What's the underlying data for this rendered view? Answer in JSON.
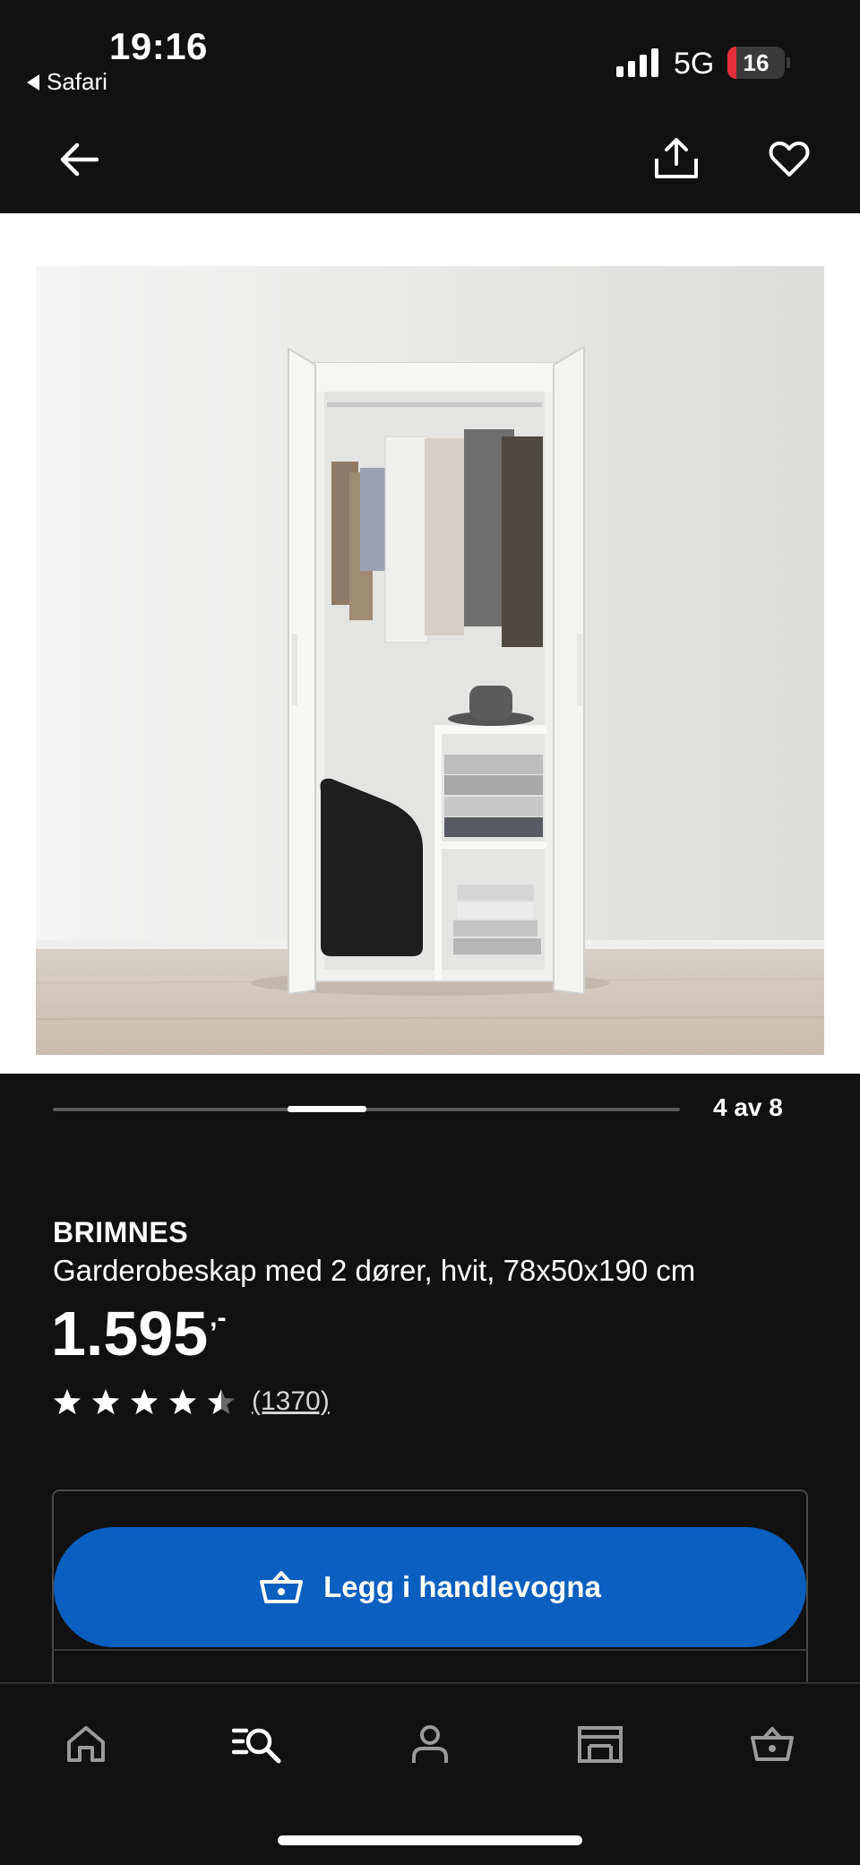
{
  "status_bar": {
    "time": "19:16",
    "back_app": "Safari",
    "network": "5G",
    "battery": "16",
    "battery_level_percent": 16
  },
  "nav": {
    "back_icon": "arrow-left-icon",
    "share_icon": "share-icon",
    "favourite_icon": "heart-icon"
  },
  "gallery": {
    "counter": "4 av 8",
    "current_index": 4,
    "total": 8,
    "image_icon": "product-photo"
  },
  "product": {
    "brand": "BRIMNES",
    "description": "Garderobeskap med 2 dører, hvit, 78x50x190 cm",
    "price": "1.595",
    "price_suffix": ",-",
    "rating_value": 4.5,
    "rating_max": 5,
    "review_count": "(1370)"
  },
  "cart": {
    "button_label": "Legg i handlevogna",
    "icon": "basket-icon",
    "color": "#0a5fbf"
  },
  "tabbar": {
    "items": [
      {
        "icon": "home-icon"
      },
      {
        "icon": "search-menu-icon"
      },
      {
        "icon": "profile-icon"
      },
      {
        "icon": "store-icon"
      },
      {
        "icon": "basket-icon"
      }
    ]
  }
}
